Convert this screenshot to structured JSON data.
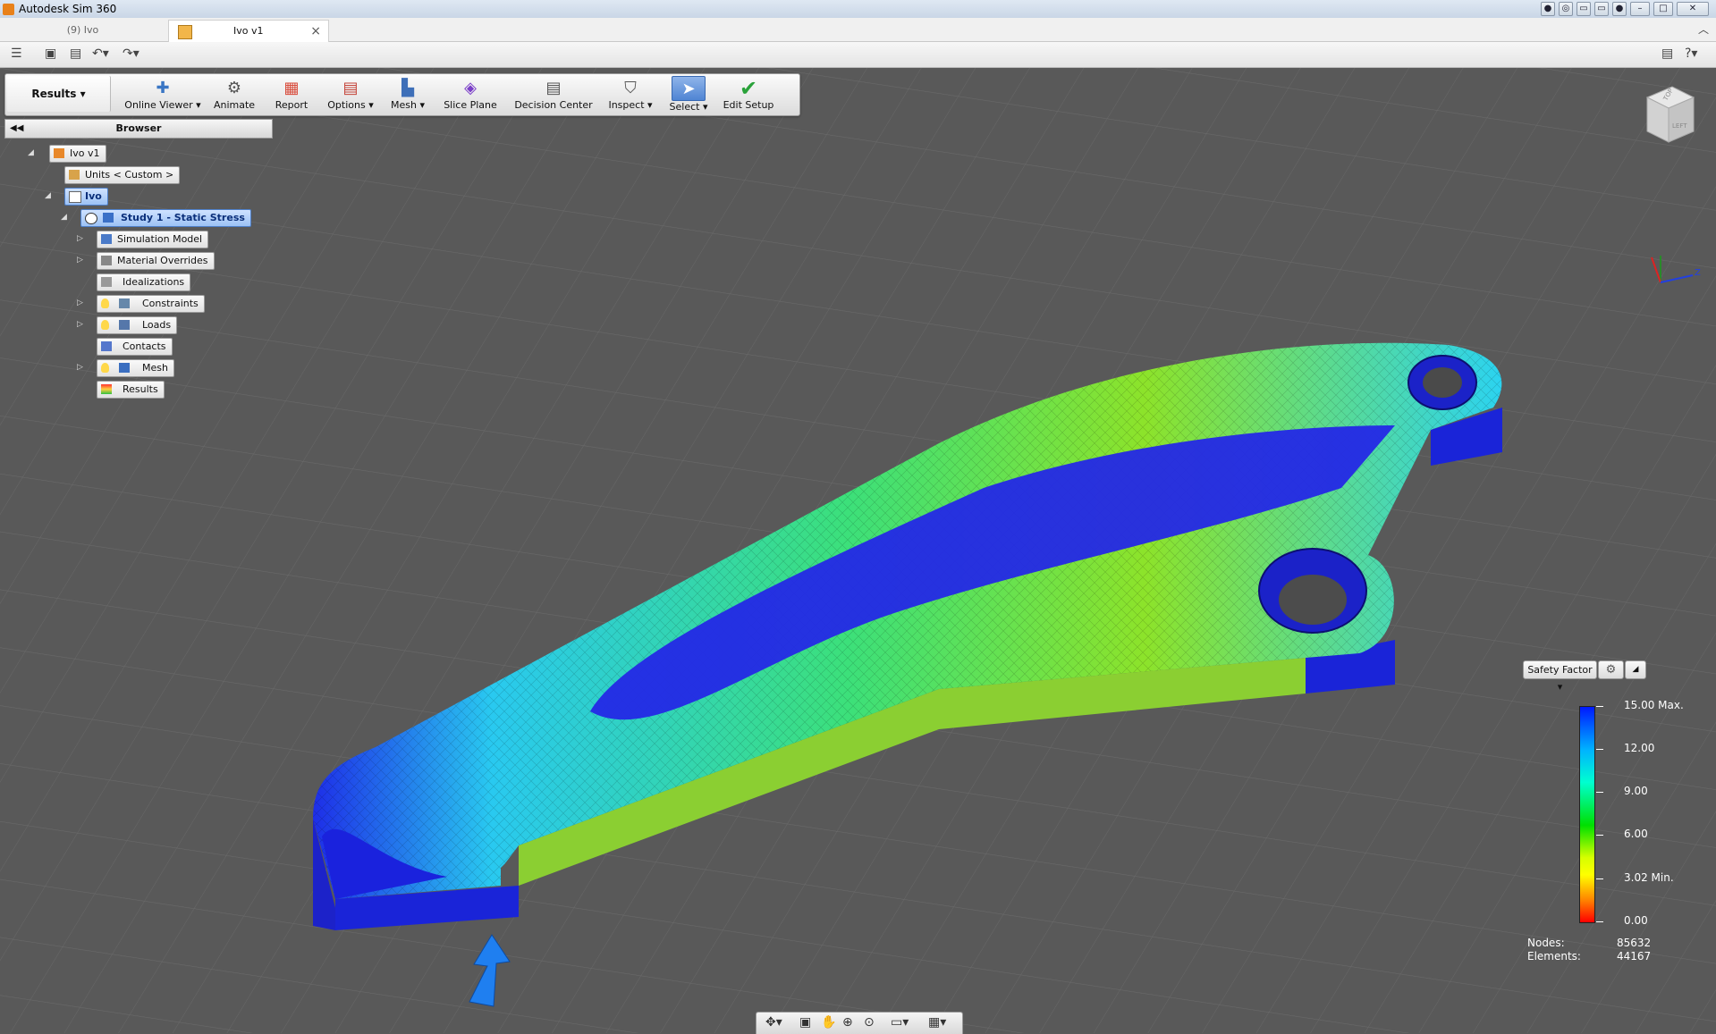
{
  "window": {
    "title": "Autodesk Sim 360"
  },
  "tabs": [
    {
      "label": "(9) Ivo"
    },
    {
      "label": "Ivo v1"
    }
  ],
  "toolbar": {
    "results_label": "Results",
    "tools": [
      {
        "label": "Online Viewer",
        "dropdown": true,
        "icon": "online-viewer-icon"
      },
      {
        "label": "Animate",
        "dropdown": false,
        "icon": "animate-icon"
      },
      {
        "label": "Report",
        "dropdown": false,
        "icon": "report-icon"
      },
      {
        "label": "Options",
        "dropdown": true,
        "icon": "options-icon"
      },
      {
        "label": "Mesh",
        "dropdown": true,
        "icon": "mesh-icon"
      },
      {
        "label": "Slice Plane",
        "dropdown": false,
        "icon": "slice-plane-icon"
      },
      {
        "label": "Decision Center",
        "dropdown": false,
        "icon": "decision-center-icon"
      },
      {
        "label": "Inspect",
        "dropdown": true,
        "icon": "inspect-icon"
      },
      {
        "label": "Select",
        "dropdown": true,
        "icon": "select-icon"
      },
      {
        "label": "Edit Setup",
        "dropdown": false,
        "icon": "edit-setup-icon"
      }
    ]
  },
  "browser": {
    "title": "Browser",
    "nodes": [
      {
        "label": "Ivo v1"
      },
      {
        "label": "Units < Custom >"
      },
      {
        "label": "Ivo"
      },
      {
        "label": "Study 1 - Static Stress"
      },
      {
        "label": "Simulation Model"
      },
      {
        "label": "Material Overrides"
      },
      {
        "label": "Idealizations"
      },
      {
        "label": "Constraints"
      },
      {
        "label": "Loads"
      },
      {
        "label": "Contacts"
      },
      {
        "label": "Mesh"
      },
      {
        "label": "Results"
      }
    ]
  },
  "legend": {
    "result_type": "Safety Factor",
    "ticks": [
      "15.00 Max.",
      "12.00",
      "9.00",
      "6.00",
      "3.02 Min.",
      "0.00"
    ],
    "max": 15.0,
    "min": 3.02,
    "range": [
      0.0,
      15.0
    ],
    "colors": [
      "#0019ff",
      "#00b3ff",
      "#00ffd0",
      "#00e000",
      "#d6ff00",
      "#ffff00",
      "#ff8000",
      "#ff0000"
    ]
  },
  "stats": {
    "nodes_label": "Nodes:",
    "nodes_value": "85632",
    "elements_label": "Elements:",
    "elements_value": "44167"
  },
  "viewcube": {
    "top": "TOP",
    "left": "LEFT"
  },
  "triad": {
    "z_label": "Z"
  }
}
